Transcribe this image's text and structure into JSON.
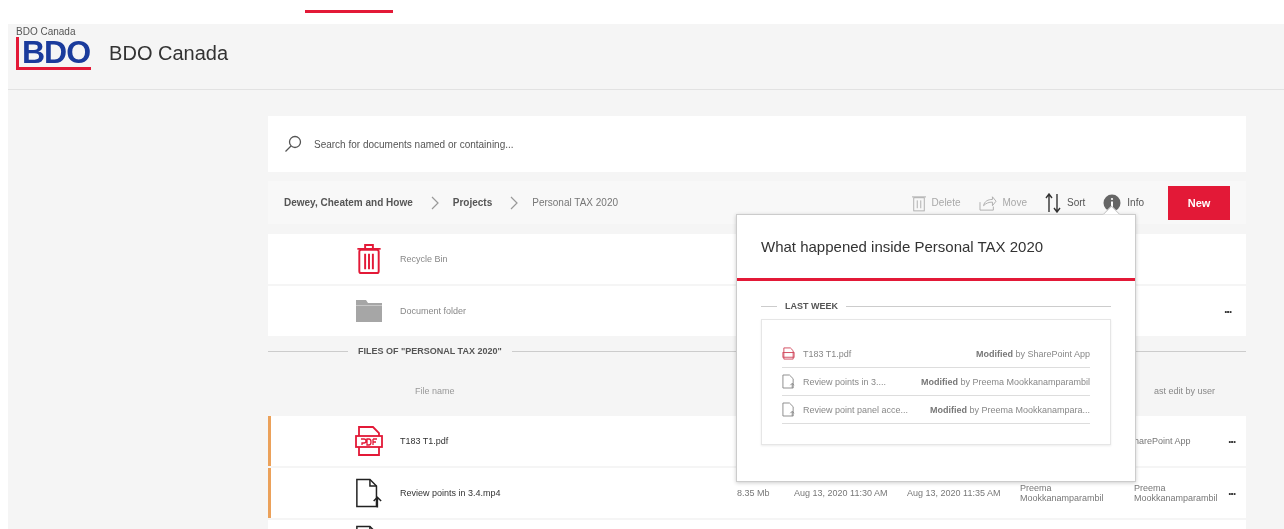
{
  "app": {
    "small_title": "BDO Canada",
    "logo": "BDO",
    "title": "BDO Canada"
  },
  "search": {
    "placeholder": "Search for documents named or containing..."
  },
  "breadcrumb": [
    {
      "label": "Dewey, Cheatem and Howe",
      "current": false
    },
    {
      "label": "Projects",
      "current": false
    },
    {
      "label": "Personal TAX 2020",
      "current": true
    }
  ],
  "toolbar": [
    {
      "kind": "delete",
      "label": "Delete",
      "disabled": true
    },
    {
      "kind": "move",
      "label": "Move",
      "disabled": true
    },
    {
      "kind": "sort",
      "label": "Sort",
      "disabled": false
    },
    {
      "kind": "info",
      "label": "Info",
      "disabled": false
    }
  ],
  "new_button": "New",
  "folders": [
    {
      "kind": "recycle",
      "name": "Recycle Bin"
    },
    {
      "kind": "folder",
      "name": "Document folder",
      "more": "···"
    }
  ],
  "files_heading": "FILES OF \"PERSONAL TAX 2020\"",
  "columns": [
    {
      "label": "File name"
    },
    {
      "label": "ast edit by user"
    }
  ],
  "files": [
    {
      "kind": "pdf",
      "name": "T183 T1.pdf",
      "highlighted": true,
      "last_edit": "harePoint App",
      "more": "···"
    },
    {
      "kind": "video",
      "name": "Review points in 3.4.mp4",
      "highlighted": true,
      "size": "8.35 Mb",
      "created": "Aug 13, 2020 11:30 AM",
      "modified": "Aug 13, 2020 11:35 AM",
      "author": "Preema Mookkanamparambil",
      "last_edit": "Preema Mookkanamparambil",
      "more": "···"
    }
  ],
  "info_popup": {
    "title": "What happened inside Personal TAX 2020",
    "group": "LAST WEEK",
    "events": [
      {
        "kind": "pdf",
        "file": "T183 T1.pdf",
        "action": "Modified",
        "by": "by SharePoint App"
      },
      {
        "kind": "doc",
        "file": "Review points in 3....",
        "action": "Modified",
        "by": "by Preema Mookkanamparambil"
      },
      {
        "kind": "doc",
        "file": "Review point panel acce...",
        "action": "Modified",
        "by": "by Preema Mookkanampara..."
      }
    ]
  }
}
